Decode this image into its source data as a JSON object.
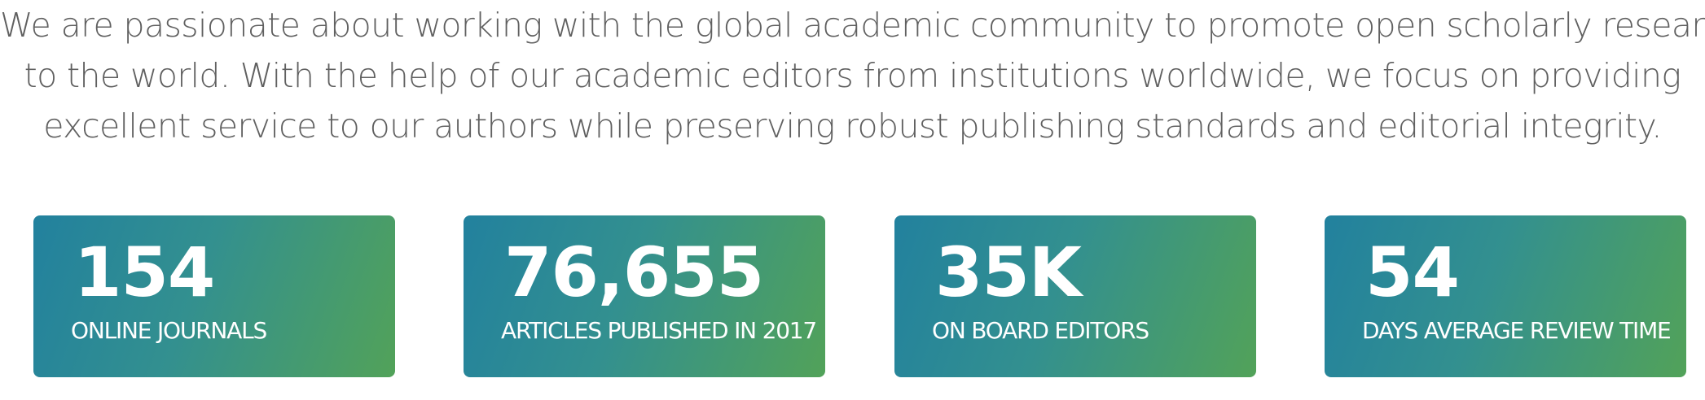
{
  "intro": {
    "line1": "We are passionate about working with the global academic community to promote open scholarly research",
    "line2": "to the world. With the help of our academic editors from institutions worldwide, we focus on providing",
    "line3": "excellent service to our authors while preserving robust publishing standards and editorial integrity."
  },
  "stats": [
    {
      "value": "154",
      "label": "ONLINE JOURNALS"
    },
    {
      "value": "76,655",
      "label": "ARTICLES PUBLISHED IN 2017"
    },
    {
      "value": "35K",
      "label": "ON BOARD EDITORS"
    },
    {
      "value": "54",
      "label": "DAYS AVERAGE REVIEW TIME"
    }
  ],
  "colors": {
    "intro_text": "#606060",
    "card_gradient_start": "#22819e",
    "card_gradient_end": "#52a259",
    "card_text": "#ffffff"
  }
}
